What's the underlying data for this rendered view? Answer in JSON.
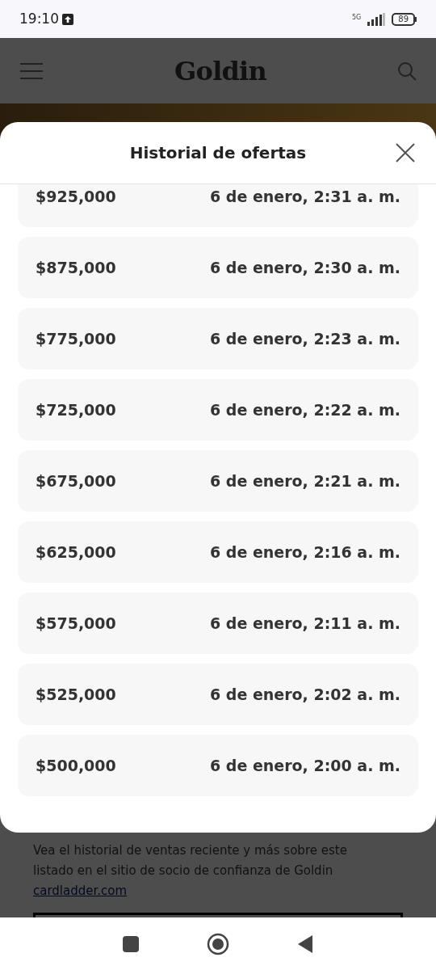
{
  "status_bar": {
    "time": "19:10",
    "network": "5G",
    "battery": "89"
  },
  "header": {
    "logo": "Goldin"
  },
  "modal": {
    "title": "Historial de ofertas",
    "bids": [
      {
        "amount": "$925,000",
        "time": "6 de enero, 2:31 a. m."
      },
      {
        "amount": "$875,000",
        "time": "6 de enero, 2:30 a. m."
      },
      {
        "amount": "$775,000",
        "time": "6 de enero, 2:23 a. m."
      },
      {
        "amount": "$725,000",
        "time": "6 de enero, 2:22 a. m."
      },
      {
        "amount": "$675,000",
        "time": "6 de enero, 2:21 a. m."
      },
      {
        "amount": "$625,000",
        "time": "6 de enero, 2:16 a. m."
      },
      {
        "amount": "$575,000",
        "time": "6 de enero, 2:11 a. m."
      },
      {
        "amount": "$525,000",
        "time": "6 de enero, 2:02 a. m."
      },
      {
        "amount": "$500,000",
        "time": "6 de enero, 2:00 a. m."
      }
    ]
  },
  "footer": {
    "text": "Vea el historial de ventas reciente y más sobre este listado en el sitio de socio de confianza de Goldin",
    "link": "cardladder.com"
  }
}
